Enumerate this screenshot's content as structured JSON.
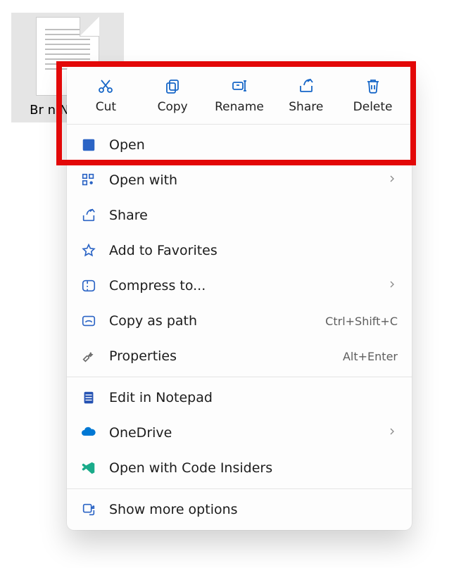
{
  "file": {
    "name": "Br n\nNotepa"
  },
  "toolbar": {
    "cut": {
      "label": "Cut"
    },
    "copy": {
      "label": "Copy"
    },
    "rename": {
      "label": "Rename"
    },
    "share": {
      "label": "Share"
    },
    "delete": {
      "label": "Delete"
    }
  },
  "menu": {
    "open": {
      "label": "Open",
      "shortcut": ""
    },
    "open_with": {
      "label": "Open with"
    },
    "share": {
      "label": "Share"
    },
    "favorites": {
      "label": "Add to Favorites"
    },
    "compress": {
      "label": "Compress to..."
    },
    "copy_path": {
      "label": "Copy as path",
      "shortcut": "Ctrl+Shift+C"
    },
    "properties": {
      "label": "Properties",
      "shortcut": "Alt+Enter"
    },
    "edit_notepad": {
      "label": "Edit in Notepad"
    },
    "onedrive": {
      "label": "OneDrive"
    },
    "code_insiders": {
      "label": "Open with Code Insiders"
    },
    "more": {
      "label": "Show more options"
    }
  }
}
